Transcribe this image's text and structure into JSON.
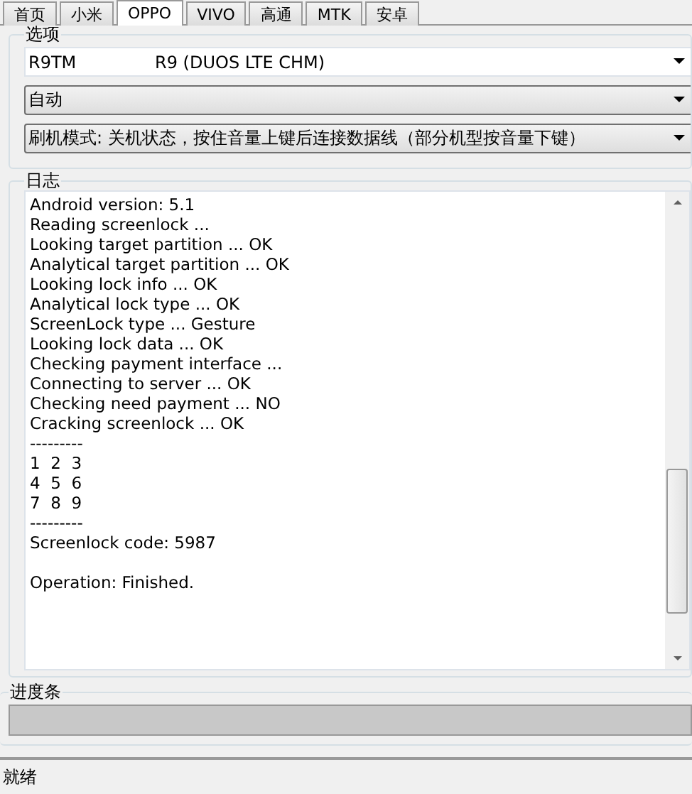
{
  "tabs": [
    {
      "label": "首页",
      "selected": false
    },
    {
      "label": "小米",
      "selected": false
    },
    {
      "label": "OPPO",
      "selected": true
    },
    {
      "label": "VIVO",
      "selected": false
    },
    {
      "label": "高通",
      "selected": false
    },
    {
      "label": "MTK",
      "selected": false
    },
    {
      "label": "安卓",
      "selected": false
    }
  ],
  "options": {
    "title": "选项",
    "model": {
      "code": "R9TM",
      "name": "R9 (DUOS LTE CHM)"
    },
    "mode": "自动",
    "flash_mode": "刷机模式: 关机状态，按住音量上键后连接数据线（部分机型按音量下键）"
  },
  "log": {
    "title": "日志",
    "lines": [
      "Android version: 5.1",
      "Reading screenlock ...",
      "Looking target partition ... OK",
      "Analytical target partition ... OK",
      "Looking lock info ... OK",
      "Analytical lock type ... OK",
      "ScreenLock type ... Gesture",
      "Looking lock data ... OK",
      "Checking payment interface ...",
      "Connecting to server ... OK",
      "Checking need payment ... NO",
      "Cracking screenlock ... OK",
      "---------",
      "1  2  3",
      "4  5  6",
      "7  8  9",
      "---------",
      "Screenlock code: 5987"
    ],
    "final_status": "Operation: Finished."
  },
  "progress": {
    "title": "进度条",
    "level": 0
  },
  "status_bar": "就绪"
}
